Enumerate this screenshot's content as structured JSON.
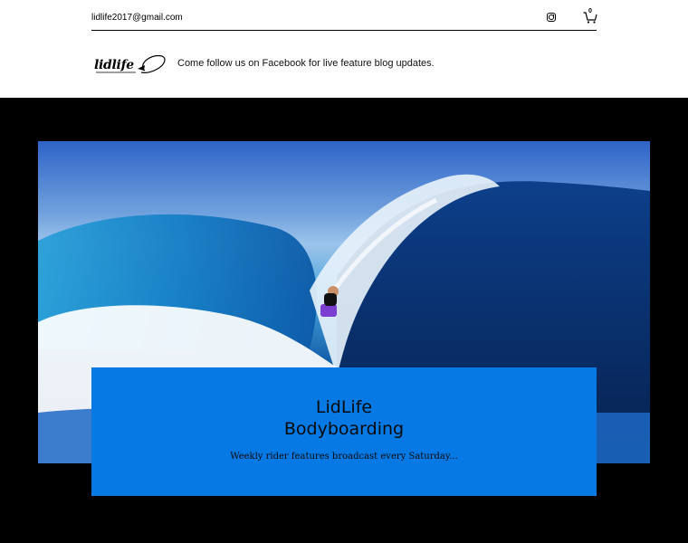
{
  "header": {
    "email": "lidlife2017@gmail.com",
    "logo_text": "lidlife",
    "tagline": "Come follow us on Facebook for live feature blog updates.",
    "cart_count": "0",
    "icons": {
      "instagram": "instagram-icon",
      "cart": "cart-icon"
    }
  },
  "hero": {
    "image": "surfer-riding-wave-image"
  },
  "card": {
    "title_line1": "LidLife",
    "title_line2": "Bodyboarding",
    "subtitle": "Weekly rider features broadcast every Saturday..."
  },
  "colors": {
    "card_bg": "#0779e4",
    "page_bg": "#000000",
    "header_bg": "#ffffff"
  }
}
